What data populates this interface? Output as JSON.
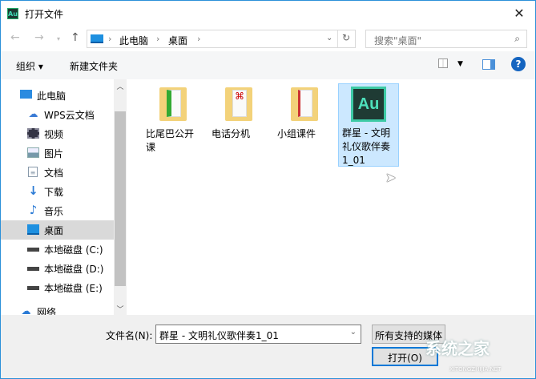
{
  "window": {
    "title": "打开文件",
    "app_icon": "Au"
  },
  "address": {
    "crumbs": [
      "此电脑",
      "桌面"
    ],
    "search_placeholder": "搜索\"桌面\""
  },
  "toolbar": {
    "organize": "组织 ▾",
    "new_folder": "新建文件夹"
  },
  "nav": {
    "items": [
      {
        "label": "此电脑",
        "icon": "computer-icon"
      },
      {
        "label": "WPS云文档",
        "icon": "cloud-icon"
      },
      {
        "label": "视频",
        "icon": "video-icon"
      },
      {
        "label": "图片",
        "icon": "picture-icon"
      },
      {
        "label": "文档",
        "icon": "document-icon"
      },
      {
        "label": "下载",
        "icon": "download-icon"
      },
      {
        "label": "音乐",
        "icon": "music-icon"
      },
      {
        "label": "桌面",
        "icon": "desktop-icon",
        "selected": true
      },
      {
        "label": "本地磁盘 (C:)",
        "icon": "drive-icon"
      },
      {
        "label": "本地磁盘 (D:)",
        "icon": "drive-icon"
      },
      {
        "label": "本地磁盘 (E:)",
        "icon": "drive-icon"
      },
      {
        "label": "网络",
        "icon": "network-icon"
      }
    ]
  },
  "files": [
    {
      "name": "比尾巴公开课",
      "type": "folder"
    },
    {
      "name": "电话分机",
      "type": "folder"
    },
    {
      "name": "小组课件",
      "type": "folder"
    },
    {
      "name": "群星 - 文明礼仪歌伴奏1_01",
      "type": "audition",
      "selected": true,
      "icon_text": "Au"
    }
  ],
  "bottom": {
    "filename_label": "文件名(N):",
    "filename_value": "群星 - 文明礼仪歌伴奏1_01",
    "filter": "所有支持的媒体",
    "open": "打开(O)"
  },
  "watermark": {
    "text": "系统之家",
    "sub": "XITONGZHIJIA.NET"
  }
}
